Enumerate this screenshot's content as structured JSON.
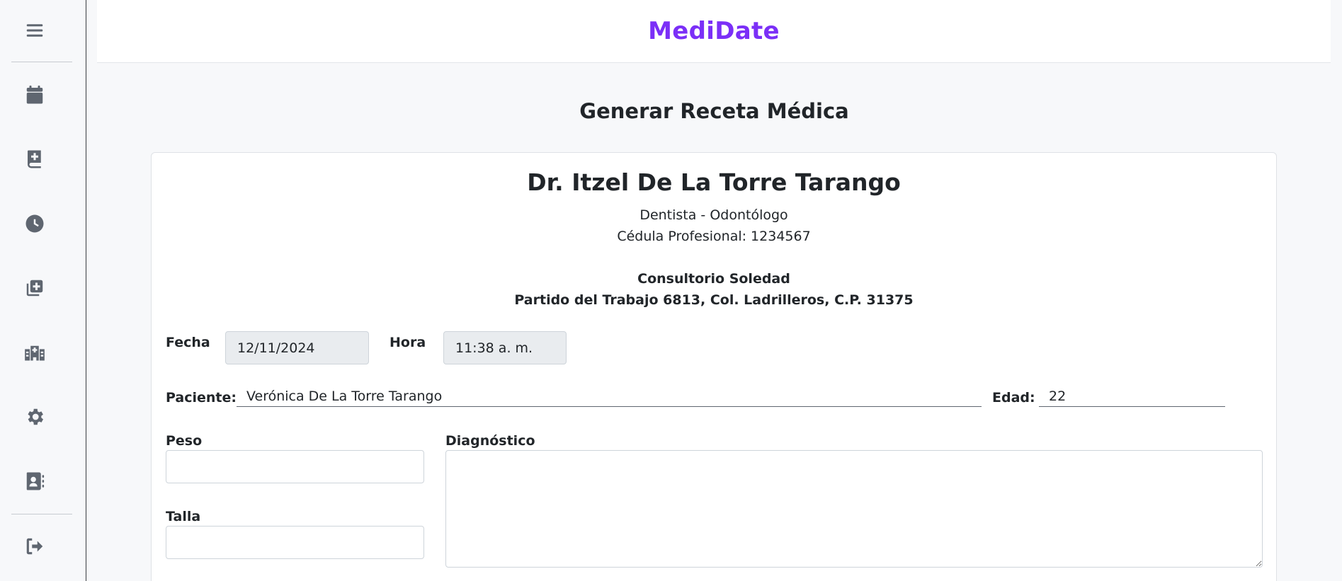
{
  "app": {
    "brand": "MediDate"
  },
  "sidebar": {
    "items": [
      {
        "icon": "menu-icon"
      },
      {
        "icon": "calendar-icon"
      },
      {
        "icon": "medical-book-icon"
      },
      {
        "icon": "clock-icon"
      },
      {
        "icon": "add-copy-icon"
      },
      {
        "icon": "hospital-icon"
      },
      {
        "icon": "gear-icon"
      },
      {
        "icon": "contact-card-icon"
      },
      {
        "icon": "logout-icon"
      }
    ]
  },
  "page": {
    "title": "Generar Receta Médica"
  },
  "prescription": {
    "doctor_name": "Dr. Itzel De La Torre Tarango",
    "specialty": "Dentista - Odontólogo",
    "license": "Cédula Profesional: 1234567",
    "clinic_name": "Consultorio Soledad",
    "clinic_address": "Partido del Trabajo 6813, Col. Ladrilleros, C.P. 31375",
    "fecha_label": "Fecha",
    "fecha_value": "12/11/2024",
    "hora_label": "Hora",
    "hora_value": "11:38 a. m.",
    "paciente_label": "Paciente:",
    "paciente_value": "Verónica De La Torre Tarango",
    "edad_label": "Edad:",
    "edad_value": "22",
    "peso_label": "Peso",
    "peso_value": "",
    "talla_label": "Talla",
    "talla_value": "",
    "diagnostico_label": "Diagnóstico",
    "diagnostico_value": ""
  }
}
